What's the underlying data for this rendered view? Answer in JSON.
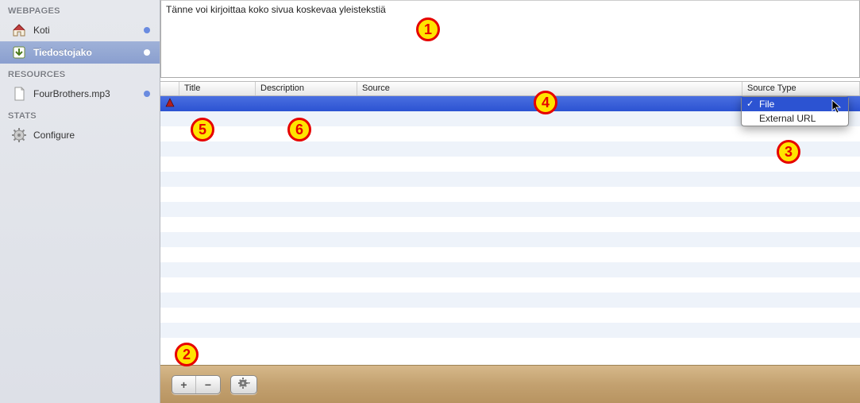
{
  "sidebar": {
    "headings": {
      "webpages": "WEBPAGES",
      "resources": "RESOURCES",
      "stats": "STATS"
    },
    "items": {
      "koti": {
        "label": "Koti"
      },
      "tiedostojako": {
        "label": "Tiedostojako"
      },
      "fourbrothers": {
        "label": "FourBrothers.mp3"
      },
      "configure": {
        "label": "Configure"
      }
    }
  },
  "description": {
    "text": "Tänne voi kirjoittaa koko sivua koskevaa yleistekstiä"
  },
  "table": {
    "columns": {
      "title": "Title",
      "description": "Description",
      "source": "Source",
      "source_type": "Source Type"
    },
    "rows": [
      {
        "title": "",
        "description": "",
        "source": "",
        "source_type": ""
      }
    ]
  },
  "dropdown": {
    "options": {
      "file": "File",
      "external_url": "External URL"
    }
  },
  "toolbar": {
    "add": "+",
    "remove": "−",
    "gear": "✻"
  },
  "callouts": {
    "c1": "1",
    "c2": "2",
    "c3": "3",
    "c4": "4",
    "c5": "5",
    "c6": "6"
  }
}
